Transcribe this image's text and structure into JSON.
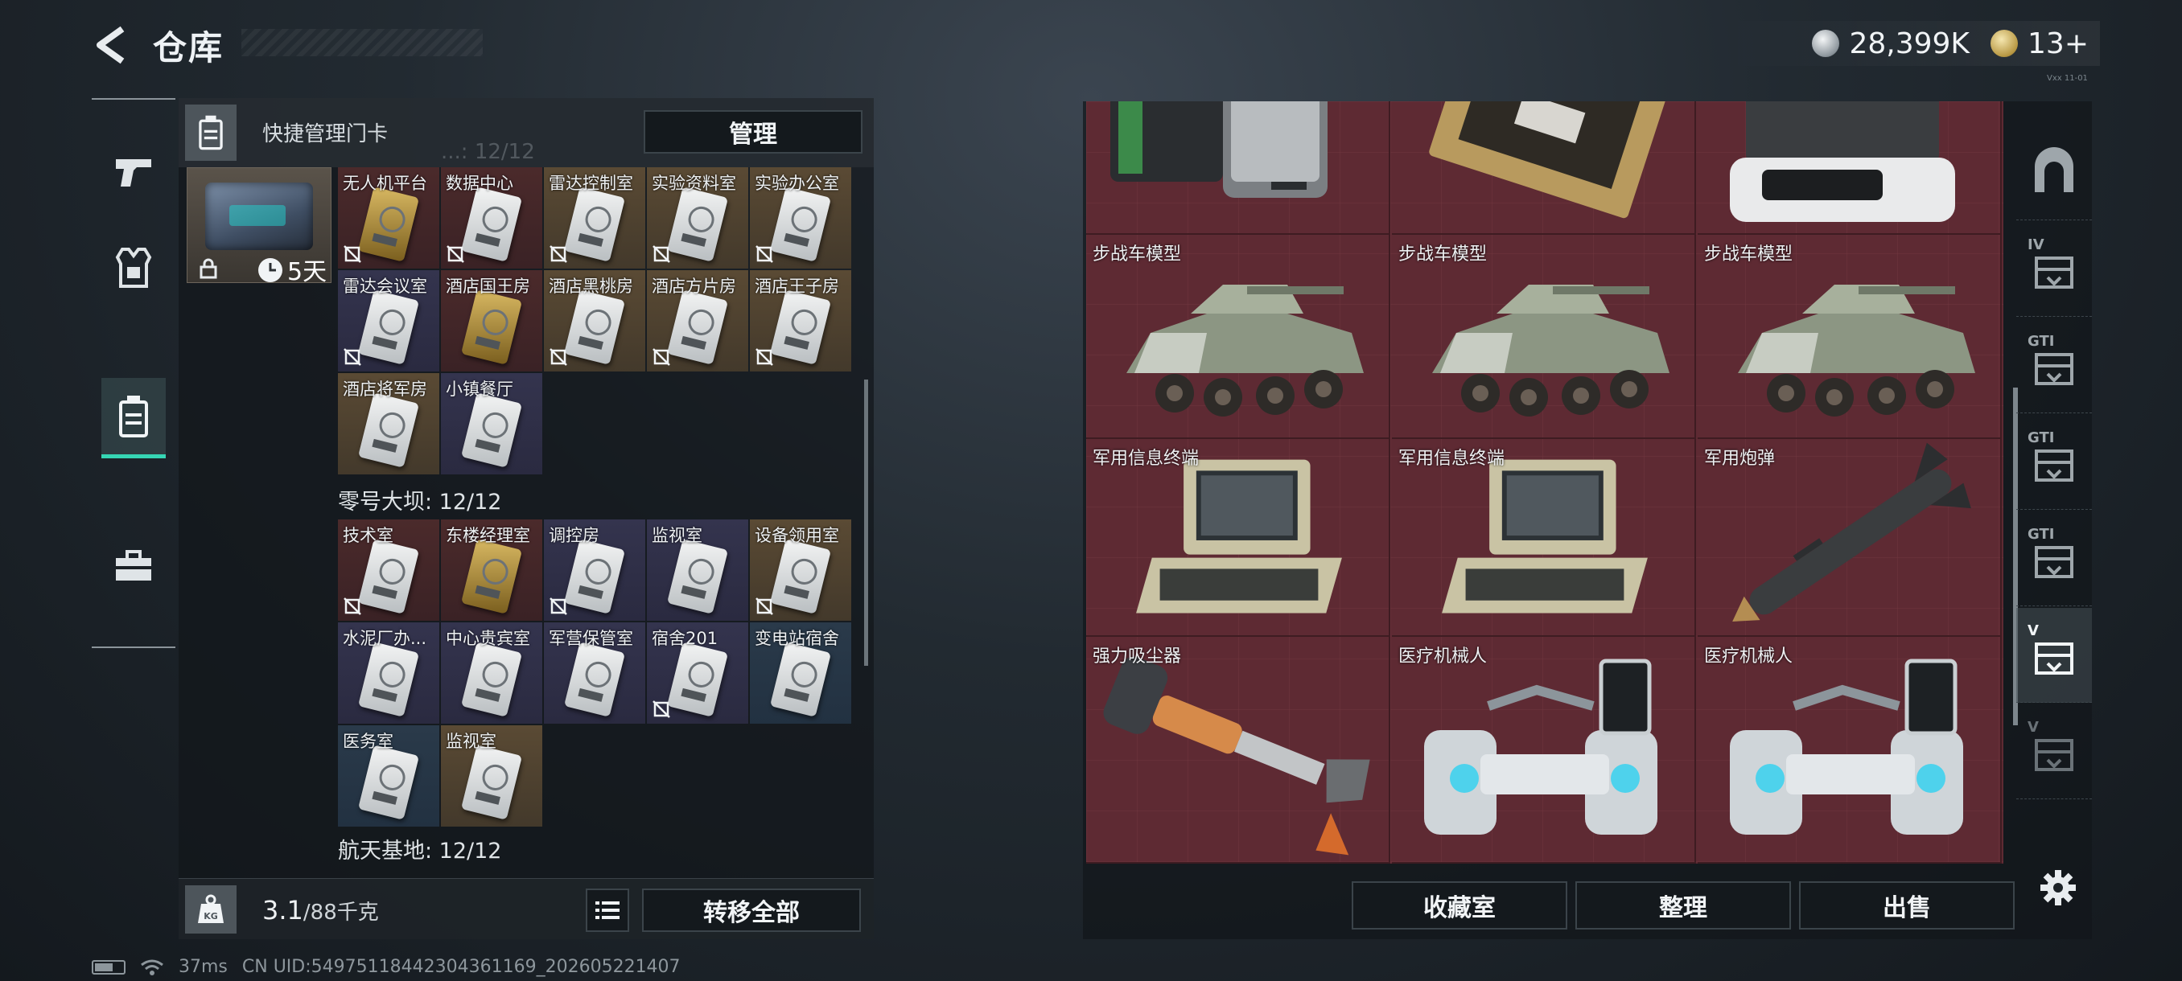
{
  "header": {
    "title": "仓库",
    "currency": [
      {
        "icon": "silver-coin-icon",
        "value": "28,399K"
      },
      {
        "icon": "gold-coin-icon",
        "value": "13+"
      }
    ],
    "corner_tag": "Vxx 11-01"
  },
  "left_nav": [
    {
      "icon": "pistol-icon",
      "active": false
    },
    {
      "icon": "armor-vest-icon",
      "active": false
    },
    {
      "icon": "keycard-holder-icon",
      "active": true
    },
    {
      "icon": "toolbox-icon",
      "active": false
    }
  ],
  "left_panel": {
    "header_title": "快捷管理门卡",
    "manage_label": "管理",
    "ghost_count": "...: 12/12",
    "card_kit": {
      "duration": "5天"
    },
    "groups": [
      {
        "label": "",
        "cards": [
          {
            "name": "无人机平台",
            "tone": "red",
            "art": "gold",
            "no_fill": true
          },
          {
            "name": "数据中心",
            "tone": "red",
            "art": "white",
            "no_fill": true
          },
          {
            "name": "雷达控制室",
            "tone": "gold",
            "art": "white",
            "no_fill": true
          },
          {
            "name": "实验资料室",
            "tone": "gold",
            "art": "white",
            "no_fill": true
          },
          {
            "name": "实验办公室",
            "tone": "gold",
            "art": "white",
            "no_fill": true
          },
          {
            "name": "雷达会议室",
            "tone": "purple",
            "art": "white",
            "no_fill": true
          },
          {
            "name": "酒店国王房",
            "tone": "red",
            "art": "gold",
            "no_fill": false
          },
          {
            "name": "酒店黑桃房",
            "tone": "gold",
            "art": "white",
            "no_fill": true
          },
          {
            "name": "酒店方片房",
            "tone": "gold",
            "art": "white",
            "no_fill": true
          },
          {
            "name": "酒店王子房",
            "tone": "gold",
            "art": "white",
            "no_fill": true
          },
          {
            "name": "酒店将军房",
            "tone": "gold",
            "art": "white",
            "no_fill": false
          },
          {
            "name": "小镇餐厅",
            "tone": "purple",
            "art": "white",
            "no_fill": false
          }
        ]
      },
      {
        "label": "零号大坝: 12/12",
        "cards": [
          {
            "name": "技术室",
            "tone": "red",
            "art": "white",
            "no_fill": true
          },
          {
            "name": "东楼经理室",
            "tone": "red",
            "art": "gold",
            "no_fill": false
          },
          {
            "name": "调控房",
            "tone": "purple",
            "art": "white",
            "no_fill": true
          },
          {
            "name": "监视室",
            "tone": "purple",
            "art": "white",
            "no_fill": false
          },
          {
            "name": "设备领用室",
            "tone": "gold",
            "art": "white",
            "no_fill": true
          },
          {
            "name": "水泥厂办...",
            "tone": "purple",
            "art": "white",
            "no_fill": false
          },
          {
            "name": "中心贵宾室",
            "tone": "purple",
            "art": "white",
            "no_fill": false
          },
          {
            "name": "军营保管室",
            "tone": "purple",
            "art": "white",
            "no_fill": false
          },
          {
            "name": "宿舍201",
            "tone": "purple",
            "art": "white",
            "no_fill": true
          },
          {
            "name": "变电站宿舍",
            "tone": "blue",
            "art": "white",
            "no_fill": false
          },
          {
            "name": "医务室",
            "tone": "blue",
            "art": "white",
            "no_fill": false
          },
          {
            "name": "监视室",
            "tone": "gold",
            "art": "white",
            "no_fill": false
          }
        ]
      }
    ],
    "next_group_label": "航天基地: 12/12",
    "footer": {
      "weight_value": "3.1",
      "weight_capacity": "/88千克",
      "transfer_all_label": "转移全部"
    }
  },
  "right_panel": {
    "items": [
      {
        "name": "",
        "art": "server"
      },
      {
        "name": "",
        "art": "circuit"
      },
      {
        "name": "",
        "art": "device"
      },
      {
        "name": "步战车模型",
        "art": "vehicle"
      },
      {
        "name": "步战车模型",
        "art": "vehicle"
      },
      {
        "name": "步战车模型",
        "art": "vehicle"
      },
      {
        "name": "军用信息终端",
        "art": "terminal"
      },
      {
        "name": "军用信息终端",
        "art": "terminal"
      },
      {
        "name": "军用炮弹",
        "art": "missile"
      },
      {
        "name": "强力吸尘器",
        "art": "vacuum"
      },
      {
        "name": "医疗机械人",
        "art": "robot"
      },
      {
        "name": "医疗机械人",
        "art": "robot"
      }
    ],
    "side_tabs": [
      {
        "icon": "arch-icon",
        "label": ""
      },
      {
        "icon": "storage-box-icon",
        "label": "IV"
      },
      {
        "icon": "storage-box-icon",
        "label": "GTI"
      },
      {
        "icon": "storage-box-icon",
        "label": "GTI"
      },
      {
        "icon": "storage-box-icon",
        "label": "GTI"
      },
      {
        "icon": "storage-box-icon",
        "label": "V"
      },
      {
        "icon": "storage-box-icon",
        "label": "V"
      }
    ],
    "buttons": {
      "collection": "收藏室",
      "organize": "整理",
      "sell": "出售"
    }
  },
  "status_bar": {
    "ping": "37ms",
    "uid": "CN UID:5497511844230436116​9_202605221407"
  }
}
